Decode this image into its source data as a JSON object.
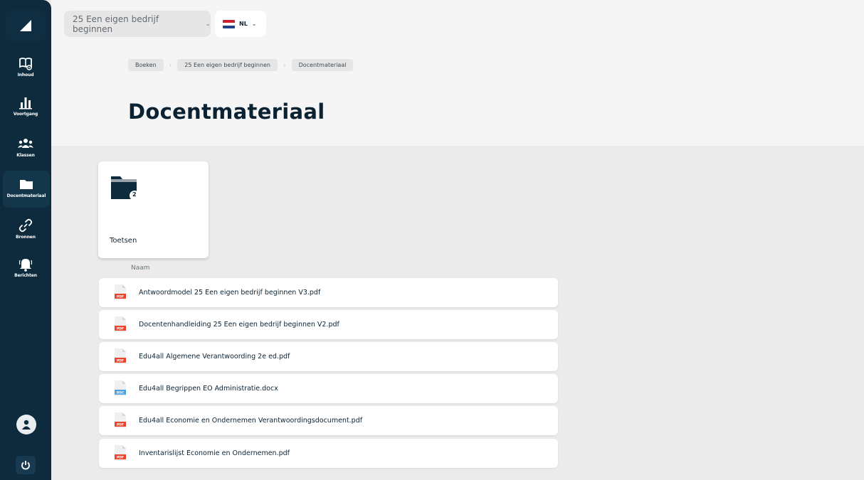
{
  "breadcrumb": [
    "Boeken",
    "25 Een eigen bedrijf beginnen",
    "Docentmateriaal"
  ],
  "header": {
    "book_select_label": "25 Een eigen bedrijf beginnen",
    "language_label": "NL"
  },
  "sidebar": {
    "items": [
      {
        "label": "Inhoud",
        "icon": "book-eye-icon"
      },
      {
        "label": "Voortgang",
        "icon": "bar-chart-icon"
      },
      {
        "label": "Klassen",
        "icon": "users-icon"
      },
      {
        "label": "Docentmateriaal",
        "icon": "folder-icon",
        "active": true
      },
      {
        "label": "Bronnen",
        "icon": "link-icon"
      },
      {
        "label": "Berichten",
        "icon": "bell-icon"
      }
    ]
  },
  "page": {
    "title": "Docentmateriaal"
  },
  "folders": [
    {
      "name": "Toetsen",
      "count": "2"
    }
  ],
  "files": {
    "column_header": "Naam",
    "rows": [
      {
        "name": "Antwoordmodel 25 Een eigen bedrijf beginnen V3.pdf",
        "type": "PDF"
      },
      {
        "name": "Docentenhandleiding 25 Een eigen bedrijf beginnen V2.pdf",
        "type": "PDF"
      },
      {
        "name": "Edu4all Algemene Verantwoording 2e ed.pdf",
        "type": "PDF"
      },
      {
        "name": "Edu4all Begrippen EO Administratie.docx",
        "type": "DOC"
      },
      {
        "name": "Edu4all Economie en Ondernemen Verantwoordingsdocument.pdf",
        "type": "PDF"
      },
      {
        "name": "Inventarislijst Economie en Ondernemen.pdf",
        "type": "PDF"
      }
    ]
  },
  "colors": {
    "sidebar": "#0d2b3d",
    "pdf": "#e8452c",
    "doc": "#4aa3df"
  }
}
